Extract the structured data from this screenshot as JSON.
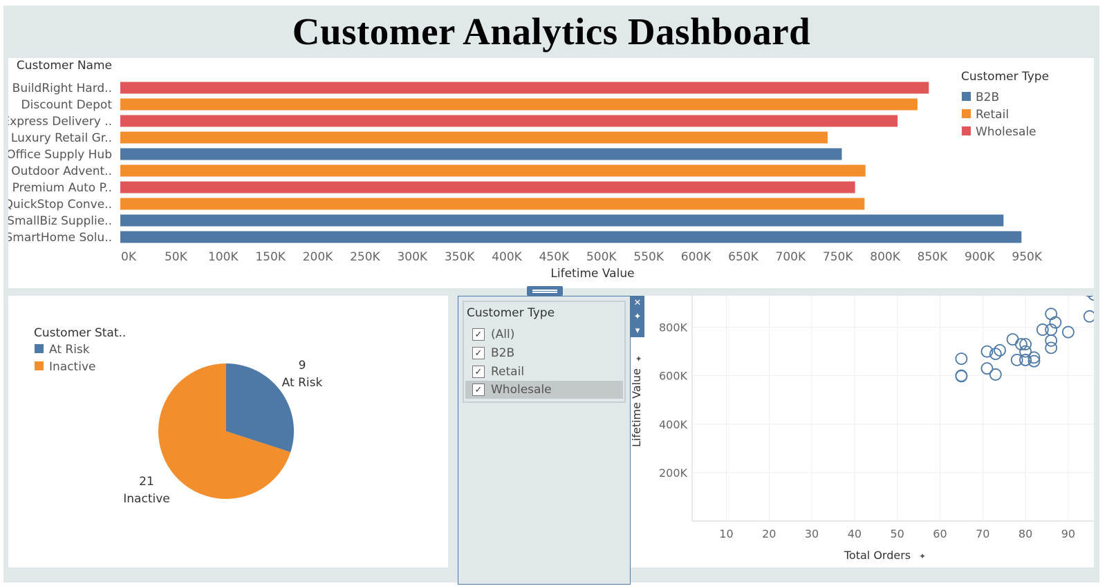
{
  "dashboard": {
    "title": "Customer Analytics Dashboard"
  },
  "bar_chart": {
    "row_header": "Customer Name",
    "axis_title": "Lifetime Value",
    "legend_title": "Customer Type",
    "legend": [
      {
        "label": "B2B",
        "color": "#4e79a7"
      },
      {
        "label": "Retail",
        "color": "#f28e2b"
      },
      {
        "label": "Wholesale",
        "color": "#e15759"
      }
    ],
    "ticks": [
      "0K",
      "50K",
      "100K",
      "150K",
      "200K",
      "250K",
      "300K",
      "350K",
      "400K",
      "450K",
      "500K",
      "550K",
      "600K",
      "650K",
      "700K",
      "750K",
      "800K",
      "850K",
      "900K",
      "950K"
    ]
  },
  "pie_chart": {
    "legend_title": "Customer Stat..",
    "legend": [
      {
        "label": "At Risk",
        "color": "#4e79a7"
      },
      {
        "label": "Inactive",
        "color": "#f28e2b"
      }
    ],
    "label_at_risk_count": "9",
    "label_at_risk_name": "At Risk",
    "label_inactive_count": "21",
    "label_inactive_name": "Inactive"
  },
  "filter": {
    "title": "Customer Type",
    "items": [
      {
        "label": "(All)",
        "checked": true
      },
      {
        "label": "B2B",
        "checked": true
      },
      {
        "label": "Retail",
        "checked": true
      },
      {
        "label": "Wholesale",
        "checked": true
      }
    ],
    "close_icon": "close-icon",
    "pin_icon": "pin-icon",
    "menu_icon": "dropdown-menu-icon"
  },
  "scatter_chart": {
    "x_title": "Total Orders",
    "y_title": "Lifetime Value",
    "x_ticks": [
      "10",
      "20",
      "30",
      "40",
      "50",
      "60",
      "70",
      "80",
      "90"
    ],
    "y_ticks": [
      "200K",
      "400K",
      "600K",
      "800K"
    ]
  },
  "chart_data": [
    {
      "type": "bar",
      "orientation": "horizontal",
      "categories": [
        "BuildRight Hard..",
        "Discount Depot",
        "Express Delivery ..",
        "Luxury Retail Gr..",
        "Office Supply Hub",
        "Outdoor Advent..",
        "Premium Auto P..",
        "QuickStop Conve..",
        "SmallBiz Supplie..",
        "SmartHome Solu.."
      ],
      "values": [
        855000,
        843000,
        822000,
        748000,
        763000,
        788000,
        777000,
        787000,
        934000,
        953000
      ],
      "customer_type": [
        "Wholesale",
        "Retail",
        "Wholesale",
        "Retail",
        "B2B",
        "Retail",
        "Wholesale",
        "Retail",
        "B2B",
        "B2B"
      ],
      "xlabel": "Lifetime Value",
      "ylabel": "Customer Name",
      "xlim": [
        0,
        1000000
      ],
      "legend_title": "Customer Type",
      "legend": "top-right",
      "grid": false
    },
    {
      "type": "pie",
      "labels": [
        "At Risk",
        "Inactive"
      ],
      "values": [
        9,
        21
      ],
      "legend_title": "Customer Stat..",
      "legend": "top-left"
    },
    {
      "type": "scatter",
      "xlabel": "Total Orders",
      "ylabel": "Lifetime Value",
      "xlim": [
        2,
        96
      ],
      "ylim": [
        0,
        930000
      ],
      "grid": true,
      "x": [
        95,
        96,
        95,
        86,
        87,
        84,
        90,
        86,
        86,
        86,
        77,
        79,
        80,
        80,
        82,
        82,
        80,
        78,
        80,
        71,
        73,
        74,
        71,
        73,
        65,
        65,
        65
      ],
      "y": [
        950000,
        935000,
        845000,
        855000,
        820000,
        790000,
        780000,
        790000,
        745000,
        715000,
        750000,
        730000,
        730000,
        700000,
        675000,
        660000,
        665000,
        665000,
        665000,
        700000,
        690000,
        705000,
        630000,
        605000,
        670000,
        600000,
        598000
      ]
    }
  ]
}
